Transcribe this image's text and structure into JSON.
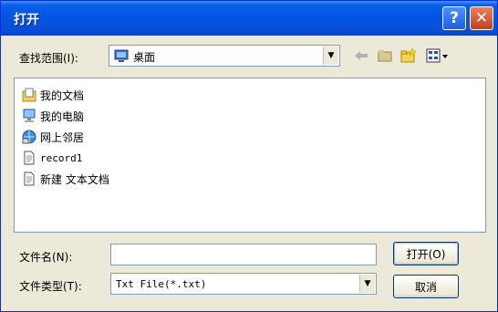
{
  "window": {
    "title": "打开"
  },
  "titlebar": {
    "help_label": "?",
    "close_label": "✕"
  },
  "toolbar": {
    "lookin_label": "查找范围(I):",
    "lookin_value": "桌面",
    "icons": [
      "back-icon",
      "up-folder-icon",
      "new-folder-icon",
      "view-menu-icon"
    ]
  },
  "files": [
    {
      "name": "我的文档",
      "icon": "my-documents-icon"
    },
    {
      "name": "我的电脑",
      "icon": "my-computer-icon"
    },
    {
      "name": "网上邻居",
      "icon": "network-places-icon"
    },
    {
      "name": "record1",
      "icon": "text-file-icon"
    },
    {
      "name": "新建 文本文档",
      "icon": "text-file-icon"
    }
  ],
  "filename": {
    "label": "文件名(N):",
    "value": ""
  },
  "filetype": {
    "label": "文件类型(T):",
    "value": "Txt File(*.txt)"
  },
  "buttons": {
    "open": "打开(O)",
    "cancel": "取消"
  }
}
